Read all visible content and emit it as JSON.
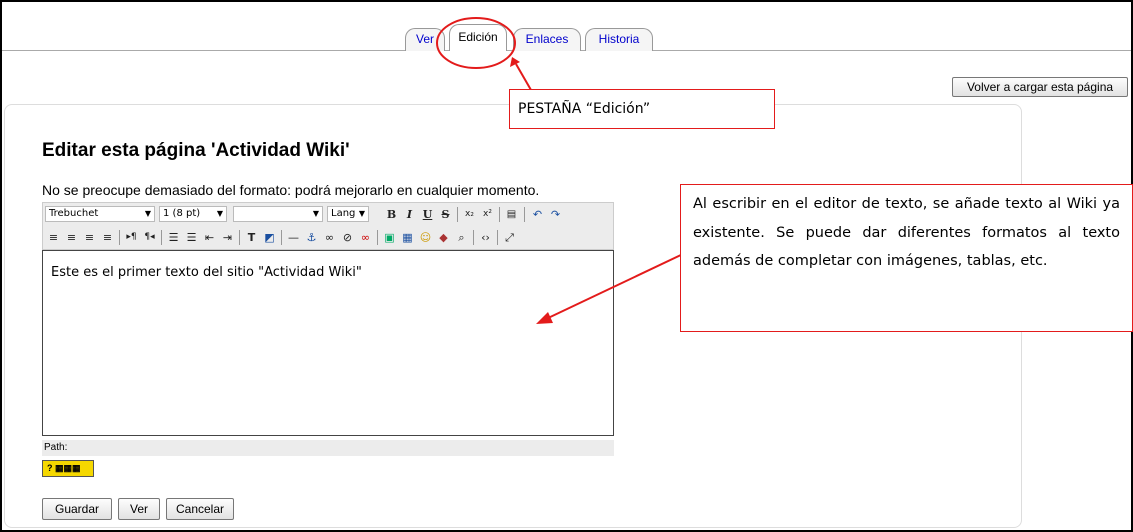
{
  "tabs": [
    {
      "label": "Ver",
      "active": false
    },
    {
      "label": "Edición",
      "active": true
    },
    {
      "label": "Enlaces",
      "active": false
    },
    {
      "label": "Historia",
      "active": false
    }
  ],
  "reload_button": "Volver a cargar esta página",
  "page_title": "Editar esta página 'Actividad Wiki'",
  "hint": "No se preocupe demasiado del formato: podrá mejorarlo en cualquier momento.",
  "toolbar": {
    "font_family": "Trebuchet",
    "font_size": "1 (8 pt)",
    "heading": "",
    "lang": "Lang",
    "bold": "B",
    "italic": "I",
    "underline": "U",
    "strike": "S"
  },
  "editor": {
    "content": "Este es el primer texto del sitio \"Actividad Wiki\""
  },
  "path_label": "Path:",
  "form_buttons": {
    "save": "Guardar",
    "preview": "Ver",
    "cancel": "Cancelar"
  },
  "annotations": {
    "tab_callout": "PESTAÑA “Edición”",
    "editor_callout": "Al escribir en el editor de texto, se añade texto al Wiki ya existente. Se puede dar diferentes formatos al texto además de completar con imágenes, tablas, etc."
  },
  "colors": {
    "annotation": "#e31b1b",
    "link": "#0000cc",
    "toolbar_bg": "#ececec"
  }
}
